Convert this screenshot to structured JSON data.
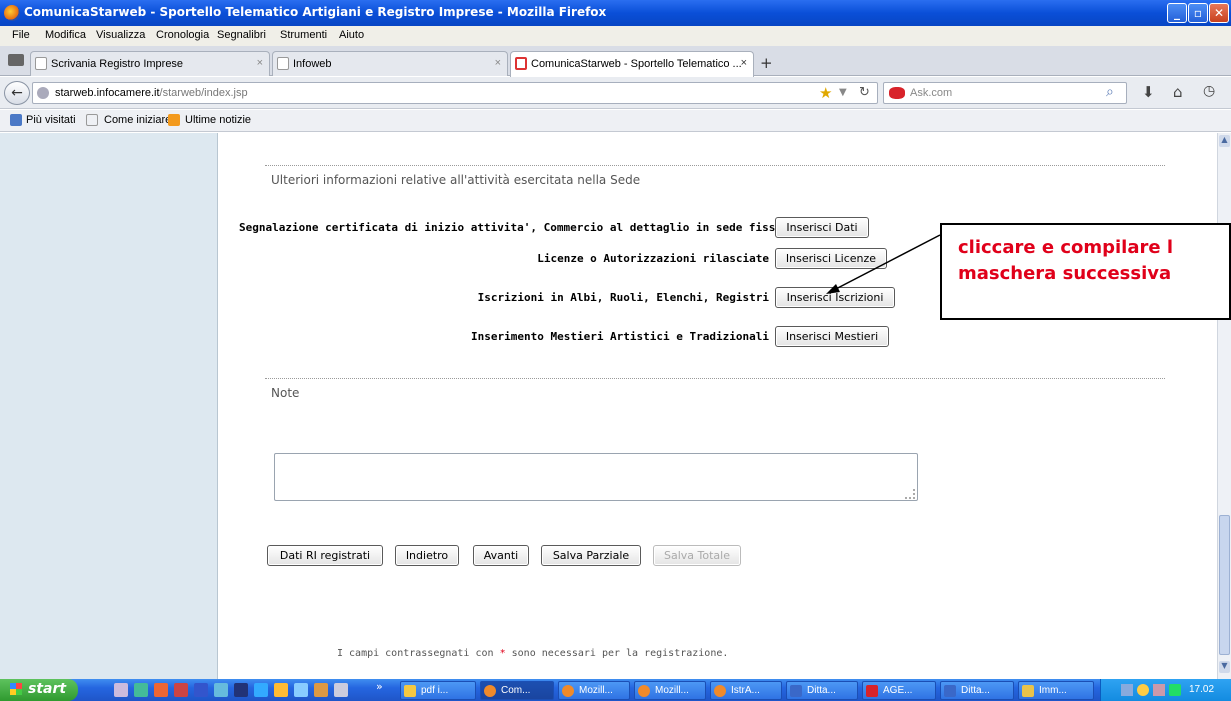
{
  "window": {
    "title": "ComunicaStarweb - Sportello Telematico Artigiani e Registro Imprese - Mozilla Firefox"
  },
  "menu": [
    "File",
    "Modifica",
    "Visualizza",
    "Cronologia",
    "Segnalibri",
    "Strumenti",
    "Aiuto"
  ],
  "tabs": [
    {
      "label": "Scrivania Registro Imprese"
    },
    {
      "label": "Infoweb"
    },
    {
      "label": "ComunicaStarweb - Sportello Telematico ..."
    }
  ],
  "tab_close": "×",
  "tab_new": "+",
  "nav": {
    "url_host": "starweb.infocamere.it",
    "url_path": "/starweb/index.jsp",
    "search_engine": "Ask.com"
  },
  "bookmarks": [
    "Più visitati",
    "Come iniziare",
    "Ultime notizie"
  ],
  "form": {
    "section_title": "Ulteriori informazioni relative all'attività esercitata nella Sede",
    "rows": [
      {
        "label": "Segnalazione certificata di inizio attivita', Commercio al dettaglio in sede fissa",
        "button": "Inserisci Dati"
      },
      {
        "label": "Licenze o Autorizzazioni rilasciate",
        "button": "Inserisci Licenze"
      },
      {
        "label": "Iscrizioni in Albi, Ruoli, Elenchi, Registri",
        "button": "Inserisci Iscrizioni"
      },
      {
        "label": "Inserimento Mestieri Artistici e Tradizionali",
        "button": "Inserisci Mestieri"
      }
    ],
    "note_title": "Note",
    "note_value": "",
    "buttons": {
      "dati_ri": "Dati RI registrati",
      "indietro": "Indietro",
      "avanti": "Avanti",
      "salva_parziale": "Salva Parziale",
      "salva_totale": "Salva Totale"
    },
    "footer_prefix": "I campi contrassegnati con",
    "footer_star": "*",
    "footer_suffix": "sono necessari per la registrazione."
  },
  "callout": {
    "line1": "cliccare e compilare l",
    "line2": "maschera successiva"
  },
  "taskbar": {
    "start": "start",
    "more": "»",
    "items": [
      "pdf i...",
      "Com...",
      "Mozill...",
      "Mozill...",
      "IstrA...",
      "Ditta...",
      "AGE...",
      "Ditta...",
      "Imm..."
    ],
    "clock": "17.02"
  },
  "colors": {
    "callout_text": "#e0001a",
    "title_bar": "#0a4fd8",
    "left_pane": "#dde8f0"
  }
}
